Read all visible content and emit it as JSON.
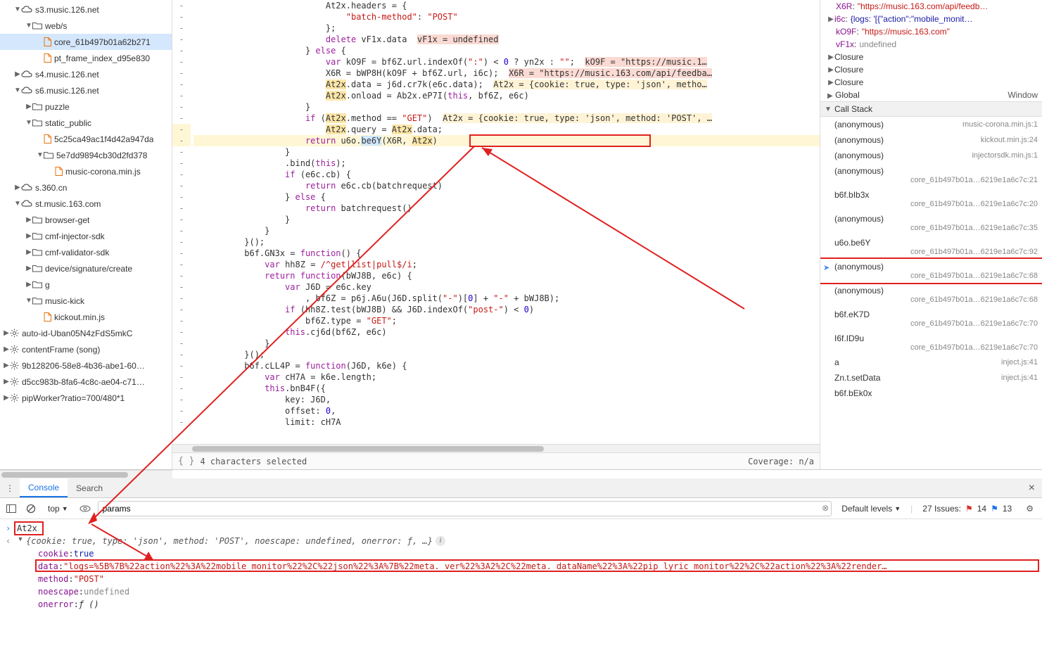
{
  "tree": [
    {
      "indent": 1,
      "tri": "▼",
      "icon": "cloud",
      "label": "s3.music.126.net"
    },
    {
      "indent": 2,
      "tri": "▼",
      "icon": "folder",
      "label": "web/s"
    },
    {
      "indent": 3,
      "tri": "",
      "icon": "file",
      "label": "core_61b497b01a62b271",
      "selected": true
    },
    {
      "indent": 3,
      "tri": "",
      "icon": "file",
      "label": "pt_frame_index_d95e830"
    },
    {
      "indent": 1,
      "tri": "▶",
      "icon": "cloud",
      "label": "s4.music.126.net"
    },
    {
      "indent": 1,
      "tri": "▼",
      "icon": "cloud",
      "label": "s6.music.126.net"
    },
    {
      "indent": 2,
      "tri": "▶",
      "icon": "folder",
      "label": "puzzle"
    },
    {
      "indent": 2,
      "tri": "▼",
      "icon": "folder",
      "label": "static_public"
    },
    {
      "indent": 3,
      "tri": "",
      "icon": "file",
      "label": "5c25ca49ac1f4d42a947da"
    },
    {
      "indent": 3,
      "tri": "▼",
      "icon": "folder",
      "label": "5e7dd9894cb30d2fd378"
    },
    {
      "indent": 4,
      "tri": "",
      "icon": "file",
      "label": "music-corona.min.js"
    },
    {
      "indent": 1,
      "tri": "▶",
      "icon": "cloud",
      "label": "s.360.cn"
    },
    {
      "indent": 1,
      "tri": "▼",
      "icon": "cloud",
      "label": "st.music.163.com"
    },
    {
      "indent": 2,
      "tri": "▶",
      "icon": "folder",
      "label": "browser-get"
    },
    {
      "indent": 2,
      "tri": "▶",
      "icon": "folder",
      "label": "cmf-injector-sdk"
    },
    {
      "indent": 2,
      "tri": "▶",
      "icon": "folder",
      "label": "cmf-validator-sdk"
    },
    {
      "indent": 2,
      "tri": "▶",
      "icon": "folder",
      "label": "device/signature/create"
    },
    {
      "indent": 2,
      "tri": "▶",
      "icon": "folder",
      "label": "g"
    },
    {
      "indent": 2,
      "tri": "▼",
      "icon": "folder",
      "label": "music-kick"
    },
    {
      "indent": 3,
      "tri": "",
      "icon": "file",
      "label": "kickout.min.js"
    },
    {
      "indent": 0,
      "tri": "▶",
      "icon": "gear",
      "label": "auto-id-Uban05N4zFdS5mkC"
    },
    {
      "indent": 0,
      "tri": "▶",
      "icon": "gear",
      "label": "contentFrame (song)"
    },
    {
      "indent": 0,
      "tri": "▶",
      "icon": "gear",
      "label": "9b128206-58e8-4b36-abe1-60…"
    },
    {
      "indent": 0,
      "tri": "▶",
      "icon": "gear",
      "label": "d5cc983b-8fa6-4c8c-ae04-c71…"
    },
    {
      "indent": 0,
      "tri": "▶",
      "icon": "gear",
      "label": "pipWorker?ratio=700/480*1"
    }
  ],
  "code_lines": [
    {
      "indent": 13,
      "html": "At2x.headers = {"
    },
    {
      "indent": 15,
      "html": "<span class='str'>\"batch-method\"</span>: <span class='str'>\"POST\"</span>"
    },
    {
      "indent": 13,
      "html": "};"
    },
    {
      "indent": 13,
      "html": "<span class='kw'>delete</span> vF1x.data  <span class='hl-red-bg'>vF1x = undefined</span>"
    },
    {
      "indent": 11,
      "html": "} <span class='kw'>else</span> {"
    },
    {
      "indent": 13,
      "html": "<span class='kw'>var</span> kO9F = bf6Z.url.indexOf(<span class='str'>\":\"</span>) < <span class='num'>0</span> ? yn2x : <span class='str'>\"\"</span>;  <span class='hl-red-bg'>kO9F = \"https://music.1…</span>"
    },
    {
      "indent": 13,
      "html": "X6R = bWP8H(kO9F + bf6Z.url, i6c);  <span class='hl-red-bg'>X6R = \"https://music.163.com/api/feedba…</span>"
    },
    {
      "indent": 13,
      "html": "<span class='hl-yellow-bg'>At2x</span>.data = j6d.cr7k(e6c.data);  <span class='hl-orange-bg'>At2x = {cookie: true, type: 'json', metho…</span>"
    },
    {
      "indent": 13,
      "html": "<span class='hl-yellow-bg'>At2x</span>.onload = Ab2x.eP7I(<span class='kw'>this</span>, bf6Z, e6c)"
    },
    {
      "indent": 11,
      "html": "}"
    },
    {
      "indent": 11,
      "html": "<span class='kw'>if</span> (<span class='hl-yellow-bg'>At2x</span>.method == <span class='str'>\"GET\"</span>)  <span class='hl-orange-bg'>At2x = {cookie: true, type: 'json', method: 'POST', …</span>"
    },
    {
      "indent": 13,
      "html": "<span class='hl-yellow-bg2'>At2x</span>.query = <span class='hl-yellow-bg2'>At2x</span>.data;",
      "paused_gutter": true
    },
    {
      "indent": 11,
      "html": "<span class='kw'>return</span> u6o.<span class='hl-blue'>be6Y</span>(X6R, <span class='hl-yellow-bg2'>At2x</span>)",
      "paused": true
    },
    {
      "indent": 9,
      "html": "}"
    },
    {
      "indent": 9,
      "html": ".bind(<span class='kw'>this</span>);"
    },
    {
      "indent": 9,
      "html": "<span class='kw'>if</span> (e6c.cb) {"
    },
    {
      "indent": 11,
      "html": "<span class='kw'>return</span> e6c.cb(batchrequest)"
    },
    {
      "indent": 9,
      "html": "} <span class='kw'>else</span> {"
    },
    {
      "indent": 11,
      "html": "<span class='kw'>return</span> batchrequest()"
    },
    {
      "indent": 9,
      "html": "}"
    },
    {
      "indent": 7,
      "html": "}"
    },
    {
      "indent": 5,
      "html": "}();"
    },
    {
      "indent": 5,
      "html": "b6f.GN3x = <span class='kw'>function</span>() {"
    },
    {
      "indent": 7,
      "html": "<span class='kw'>var</span> hh8Z = <span class='str'>/^get|list|pull$/i</span>;"
    },
    {
      "indent": 7,
      "html": "<span class='kw'>return function</span>(bWJ8B, e6c) {"
    },
    {
      "indent": 9,
      "html": "<span class='kw'>var</span> J6D = e6c.key"
    },
    {
      "indent": 11,
      "html": ", bf6Z = p6j.A6u(J6D.split(<span class='str'>\"-\"</span>)[<span class='num'>0</span>] + <span class='str'>\"-\"</span> + bWJ8B);"
    },
    {
      "indent": 9,
      "html": "<span class='kw'>if</span> (hh8Z.test(bWJ8B) && J6D.indexOf(<span class='str'>\"post-\"</span>) < <span class='num'>0</span>)"
    },
    {
      "indent": 11,
      "html": "bf6Z.type = <span class='str'>\"GET\"</span>;"
    },
    {
      "indent": 9,
      "html": "<span class='kw'>this</span>.cj6d(bf6Z, e6c)"
    },
    {
      "indent": 7,
      "html": "}"
    },
    {
      "indent": 5,
      "html": "}();"
    },
    {
      "indent": 5,
      "html": "b6f.cLL4P = <span class='kw'>function</span>(J6D, k6e) {"
    },
    {
      "indent": 7,
      "html": "<span class='kw'>var</span> cH7A = k6e.length;"
    },
    {
      "indent": 7,
      "html": "<span class='kw'>this</span>.bnB4F({"
    },
    {
      "indent": 9,
      "html": "key: J6D,"
    },
    {
      "indent": 9,
      "html": "offset: <span class='num'>0</span>,"
    },
    {
      "indent": 9,
      "html": "limit: cH7A"
    }
  ],
  "scope": [
    {
      "key": "X6R",
      "type": "str",
      "val": "\"https://music.163.com/api/feedb…"
    },
    {
      "key": "i6c",
      "type": "obj",
      "tri": "▶",
      "val": "{logs: '[{\"action\":\"mobile_monit…"
    },
    {
      "key": "kO9F",
      "type": "str",
      "val": "\"https://music.163.com\""
    },
    {
      "key": "vF1x",
      "type": "undef",
      "val": "undefined"
    }
  ],
  "closures": [
    {
      "tri": "▶",
      "label": "Closure"
    },
    {
      "tri": "▶",
      "label": "Closure"
    },
    {
      "tri": "▶",
      "label": "Closure"
    }
  ],
  "global": {
    "tri": "▶",
    "label": "Global",
    "right": "Window"
  },
  "callstack_header": "Call Stack",
  "callstack": [
    {
      "name": "(anonymous)",
      "loc": "music-corona.min.js:1",
      "single": true
    },
    {
      "name": "(anonymous)",
      "loc": "kickout.min.js:24",
      "single": true
    },
    {
      "name": "(anonymous)",
      "loc": "injectorsdk.min.js:1",
      "single": true
    },
    {
      "name": "(anonymous)",
      "loc": "core_61b497b01a…6219e1a6c7c:21"
    },
    {
      "name": "b6f.bIb3x",
      "loc": "core_61b497b01a…6219e1a6c7c:20"
    },
    {
      "name": "(anonymous)",
      "loc": "core_61b497b01a…6219e1a6c7c:35"
    },
    {
      "name": "u6o.be6Y",
      "loc": "core_61b497b01a…6219e1a6c7c:92"
    },
    {
      "name": "(anonymous)",
      "loc": "core_61b497b01a…6219e1a6c7c:68",
      "current": true
    },
    {
      "name": "(anonymous)",
      "loc": "core_61b497b01a…6219e1a6c7c:68"
    },
    {
      "name": "b6f.eK7D",
      "loc": "core_61b497b01a…6219e1a6c7c:70"
    },
    {
      "name": "I6f.ID9u",
      "loc": "core_61b497b01a…6219e1a6c7c:70"
    },
    {
      "name": "a",
      "loc": "inject.js:41",
      "single": true
    },
    {
      "name": "Zn.t.setData",
      "loc": "inject.js:41",
      "single": true
    },
    {
      "name": "b6f.bEk0x",
      "loc": ""
    }
  ],
  "status": {
    "chars": "4 characters selected",
    "coverage": "Coverage: n/a"
  },
  "tabs": {
    "console": "Console",
    "search": "Search"
  },
  "toolbar": {
    "top": "top",
    "filter_value": "params",
    "levels": "Default levels",
    "issues_label": "27 Issues:",
    "err_count": "14",
    "info_count": "13"
  },
  "console": {
    "input": "At2x",
    "summary": "{cookie: true, type: 'json', method: 'POST', noescape: undefined, onerror: ƒ, …}",
    "rows": [
      {
        "key": "cookie",
        "type": "lit",
        "val": "true"
      },
      {
        "key": "data",
        "type": "str",
        "val": "\"logs=%5B%7B%22action%22%3A%22mobile_monitor%22%2C%22json%22%3A%7B%22meta._ver%22%3A2%2C%22meta._dataName%22%3A%22pip_lyric_monitor%22%2C%22action%22%3A%22render…"
      },
      {
        "key": "method",
        "type": "str",
        "val": "\"POST\""
      },
      {
        "key": "noescape",
        "type": "undef",
        "val": "undefined"
      },
      {
        "key": "onerror",
        "type": "fn",
        "val": "ƒ ()"
      }
    ]
  }
}
